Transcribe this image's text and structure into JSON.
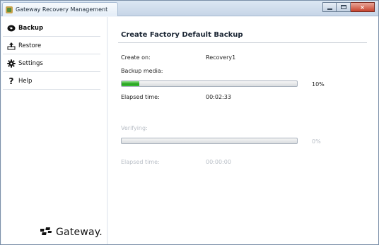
{
  "window": {
    "title": "Gateway Recovery Management",
    "controls": {
      "minimize": "minimize-icon",
      "maximize": "maximize-icon",
      "close": "×"
    }
  },
  "sidebar": {
    "items": [
      {
        "label": "Backup",
        "icon": "disc-icon",
        "active": true
      },
      {
        "label": "Restore",
        "icon": "restore-icon",
        "active": false
      },
      {
        "label": "Settings",
        "icon": "gear-icon",
        "active": false
      },
      {
        "label": "Help",
        "icon": "help-icon",
        "active": false
      }
    ],
    "logo_text": "Gateway."
  },
  "main": {
    "title": "Create Factory Default Backup",
    "create_on_label": "Create on:",
    "create_on_value": "Recovery1",
    "backup_media_label": "Backup media:",
    "backup_progress_percent": 10,
    "backup_progress_text": "10%",
    "elapsed_label": "Elapsed time:",
    "elapsed_value": "00:02:33",
    "verifying_label": "Verifying:",
    "verify_progress_percent": 0,
    "verify_progress_text": "0%",
    "verify_elapsed_label": "Elapsed time:",
    "verify_elapsed_value": "00:00:00"
  },
  "colors": {
    "progress_fill": "#26a31f",
    "dim_text": "#b8bec6"
  }
}
